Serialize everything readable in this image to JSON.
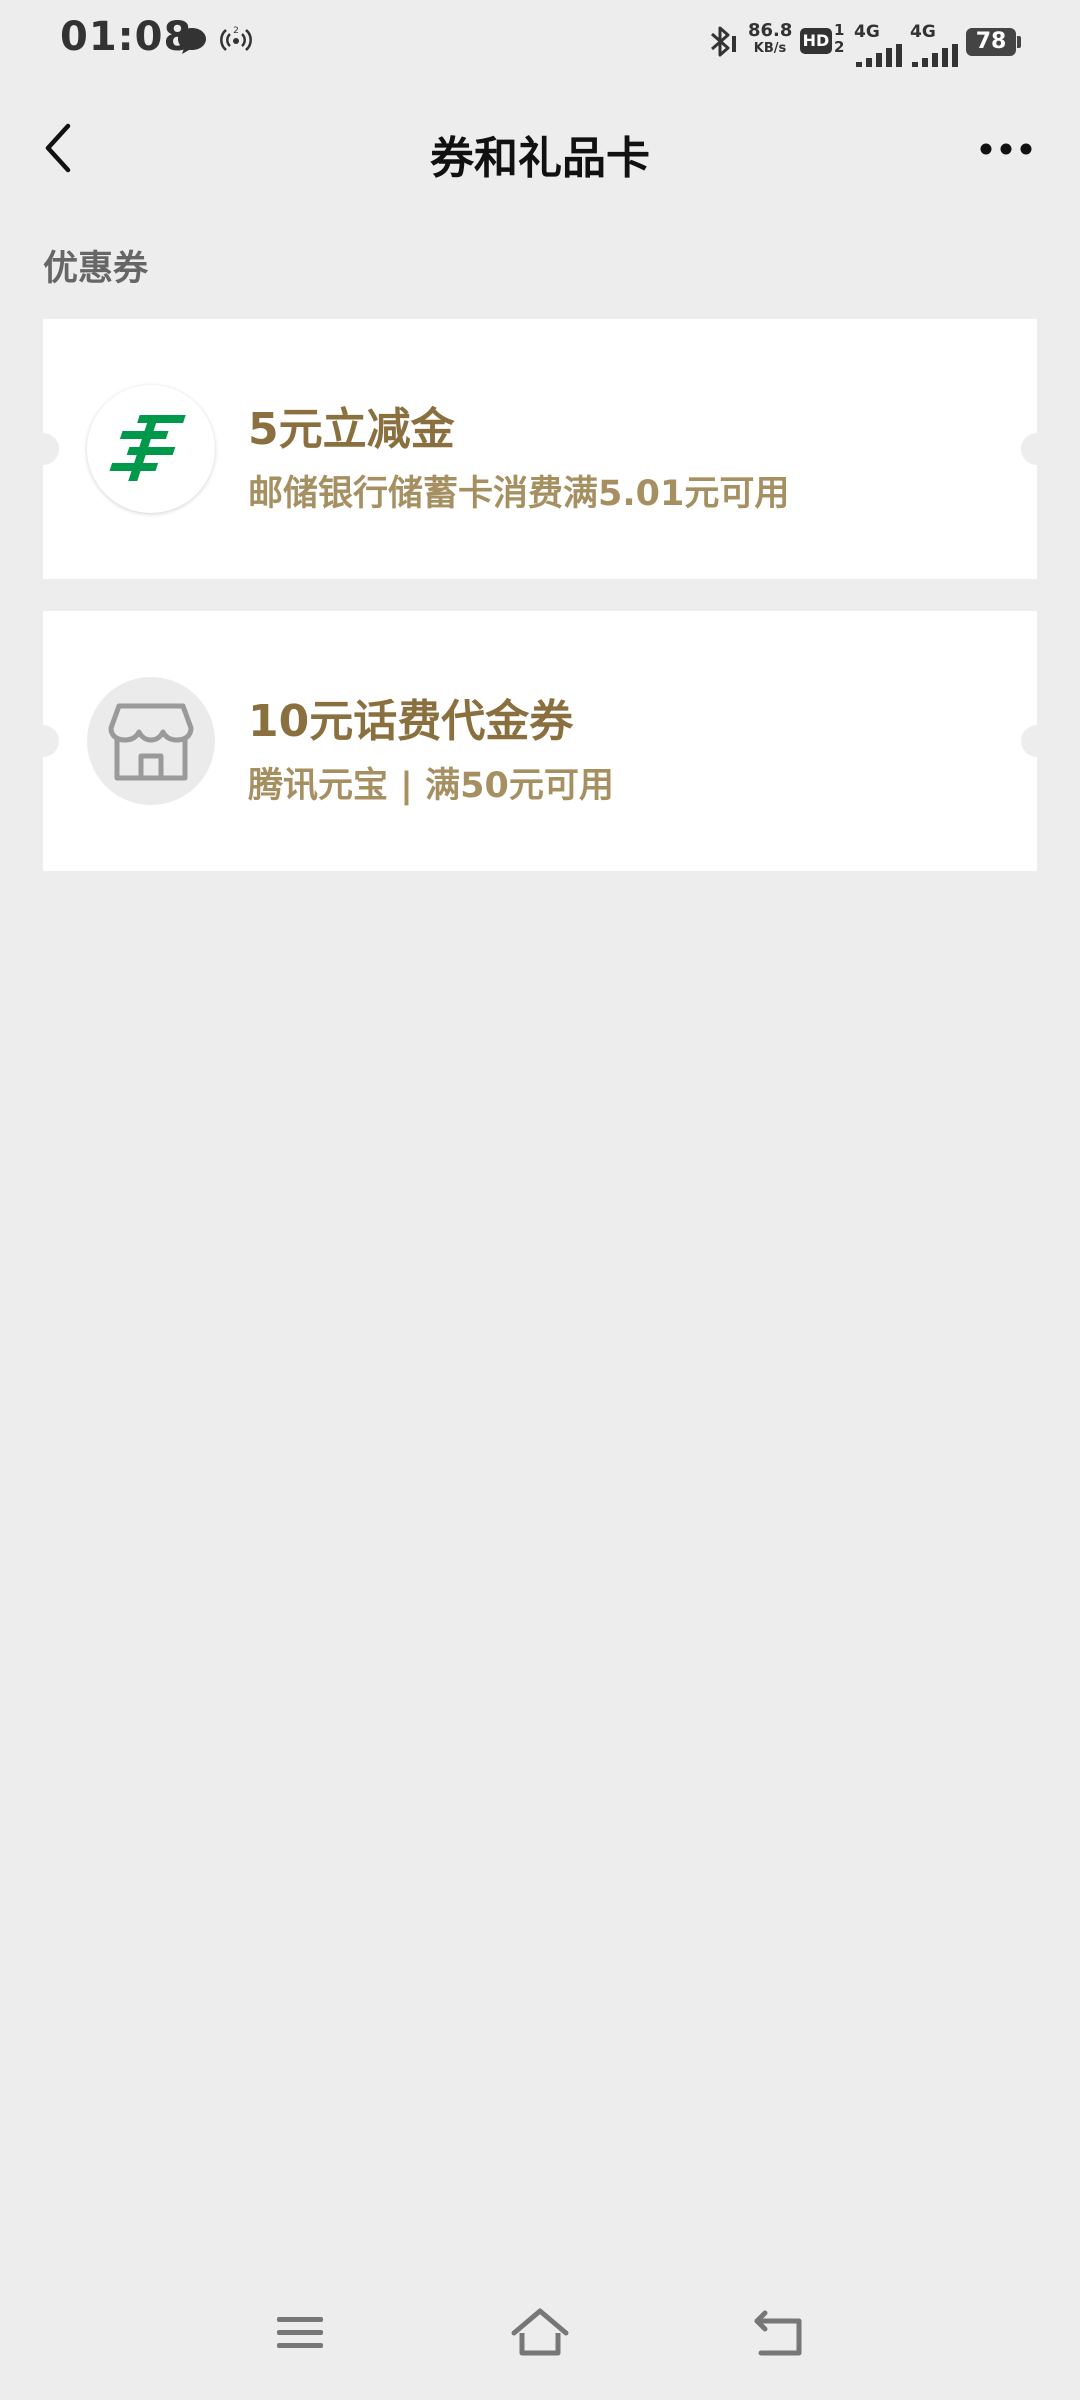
{
  "status_bar": {
    "time": "01:08",
    "speed_value": "86.8",
    "speed_unit": "KB/s",
    "hd_label": "HD",
    "hd_sub": "1\n2",
    "network1": "4G",
    "network2": "4G",
    "battery": "78"
  },
  "header": {
    "title": "券和礼品卡",
    "back_icon": "chevron-left-icon",
    "more_icon": "more-dots-icon"
  },
  "section": {
    "label": "优惠券"
  },
  "coupons": [
    {
      "title": "5元立减金",
      "subtitle": "邮储银行储蓄卡消费满5.01元可用",
      "logo": "postal-bank-logo"
    },
    {
      "title": "10元话费代金券",
      "subtitle": "腾讯元宝 | 满50元可用",
      "logo": "store-icon"
    }
  ],
  "colors": {
    "background": "#ededed",
    "card": "#ffffff",
    "coupon_title": "#8a6f3f",
    "coupon_sub": "#a69062",
    "postal_green": "#00984a"
  }
}
